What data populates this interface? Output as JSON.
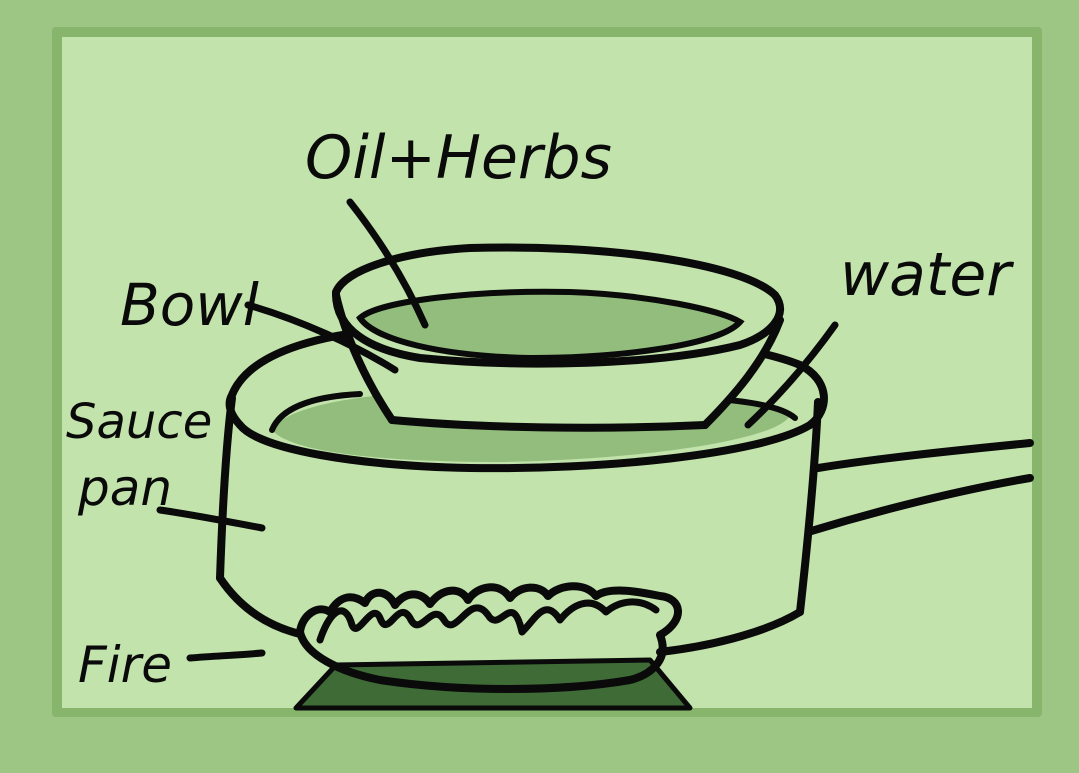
{
  "labels": {
    "oil_herbs": "Oil+Herbs",
    "bowl": "Bowl",
    "water": "water",
    "sauce": "Sauce",
    "pan": "pan",
    "fire": "Fire"
  },
  "colors": {
    "outer_background": "#9dc584",
    "frame_border": "#86b56b",
    "panel_fill": "#c2e3ab",
    "liquid_fill": "#92bd7c",
    "stove_fill": "#3f6b37",
    "ink": "#0a0a0a"
  }
}
